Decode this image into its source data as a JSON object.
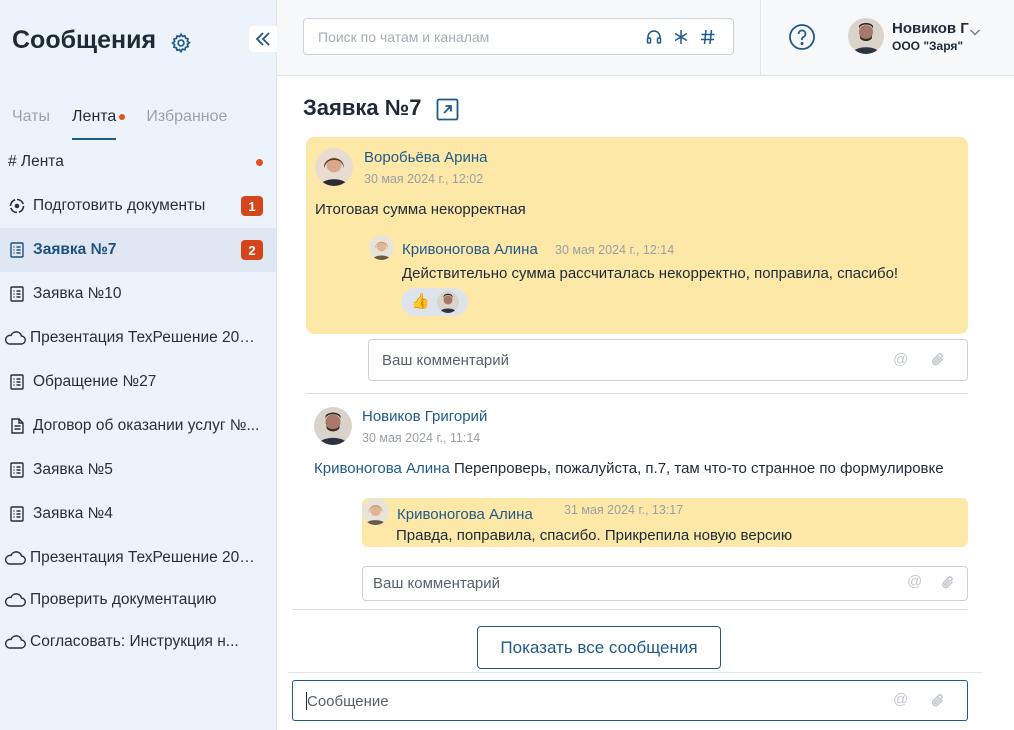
{
  "sidebar": {
    "title": "Сообщения",
    "tabs": [
      {
        "label": "Чаты"
      },
      {
        "label": "Лента"
      },
      {
        "label": "Избранное"
      }
    ],
    "items": [
      {
        "label": "# Лента",
        "icon": "",
        "badge": "",
        "dot": true
      },
      {
        "label": "Подготовить документы",
        "icon": "process-icon",
        "badge": "1"
      },
      {
        "label": "Заявка №7",
        "icon": "list-doc-icon",
        "badge": "2",
        "active": true
      },
      {
        "label": "Заявка №10",
        "icon": "list-doc-icon",
        "badge": ""
      },
      {
        "label": "Презентация ТехРешение 202...",
        "icon": "cloud-icon",
        "badge": ""
      },
      {
        "label": "Обращение №27",
        "icon": "list-doc-icon",
        "badge": ""
      },
      {
        "label": "Договор об оказании услуг №...",
        "icon": "document-icon",
        "badge": ""
      },
      {
        "label": "Заявка №5",
        "icon": "list-doc-icon",
        "badge": ""
      },
      {
        "label": "Заявка №4",
        "icon": "list-doc-icon",
        "badge": ""
      },
      {
        "label": "Презентация ТехРешение 202...",
        "icon": "cloud-icon",
        "badge": ""
      },
      {
        "label": "Проверить документацию",
        "icon": "cloud-icon",
        "badge": ""
      },
      {
        "label": "Согласовать: Инструкция н...",
        "icon": "cloud-icon",
        "badge": ""
      }
    ]
  },
  "topbar": {
    "search_placeholder": "Поиск по чатам и каналам",
    "user_name": "Новиков Г",
    "user_org": "ООО \"Заря\""
  },
  "main": {
    "title": "Заявка №7",
    "post1": {
      "author": "Воробьёва Арина",
      "time": "30 мая 2024 г., 12:02",
      "text": "Итоговая сумма некорректная",
      "reply": {
        "author": "Кривоногова Алина",
        "time": "30 мая 2024 г., 12:14",
        "text": "Действительно сумма рассчиталась некорректно, поправила, спасибо!"
      },
      "comment_placeholder": "Ваш комментарий"
    },
    "post2": {
      "author": "Новиков Григорий",
      "time": "30 мая 2024 г., 11:14",
      "mention": "Кривоногова Алина",
      "text": "Перепроверь, пожалуйста, п.7, там что-то странное по формулировке",
      "reply": {
        "author": "Кривоногова Алина",
        "time": "31 мая 2024 г., 13:17",
        "text": "Правда, поправила, спасибо. Прикрепила новую версию"
      },
      "comment_placeholder": "Ваш комментарий"
    },
    "show_all_label": "Показать все сообщения",
    "message_placeholder": "Сообщение"
  },
  "colors": {
    "accent": "#1f5a8b",
    "badge": "#d5451c",
    "highlight": "#fde8a8",
    "sidebar_bg": "#edf3fa"
  }
}
